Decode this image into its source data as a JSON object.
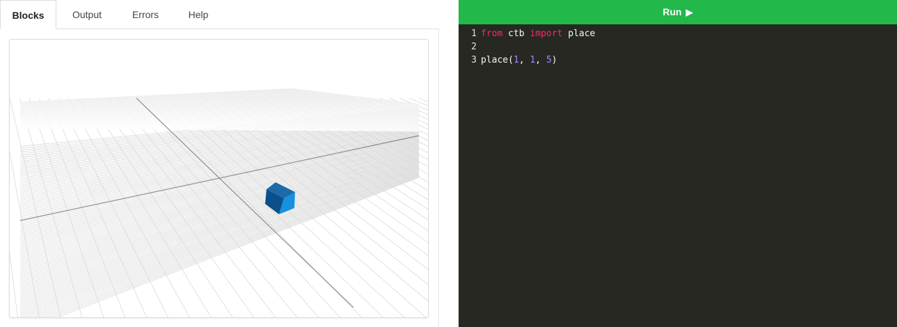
{
  "tabs": {
    "blocks": "Blocks",
    "output": "Output",
    "errors": "Errors",
    "help": "Help"
  },
  "run_button": {
    "label": "Run",
    "icon": "play-icon"
  },
  "code": {
    "line1": {
      "number": "1",
      "kw_from": "from",
      "module": " ctb ",
      "kw_import": "import",
      "name": " place"
    },
    "line2": {
      "number": "2"
    },
    "line3": {
      "number": "3",
      "func": "place(",
      "a": "1",
      "sep1": ", ",
      "b": "1",
      "sep2": ", ",
      "c": "5",
      "close": ")"
    }
  },
  "colors": {
    "run_green": "#22b84a",
    "editor_bg": "#272822",
    "keyword": "#f92672",
    "number": "#ae81ff",
    "cube_dark": "#0b4f8a",
    "cube_light": "#1591e0"
  }
}
